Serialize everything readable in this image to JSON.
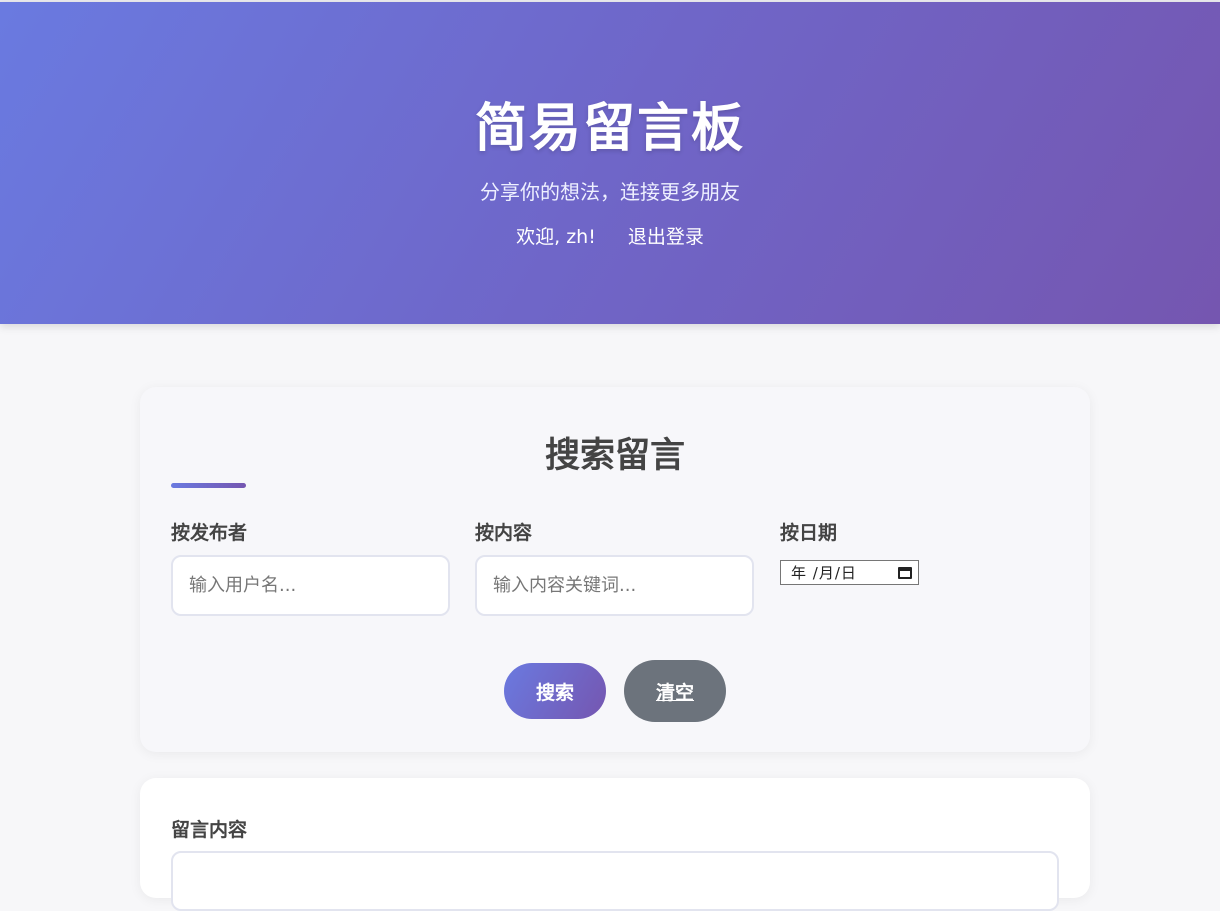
{
  "header": {
    "title": "简易留言板",
    "subtitle": "分享你的想法，连接更多朋友",
    "welcome": "欢迎, zh!",
    "logout_label": "退出登录",
    "gradient_start": "#6a7ae0",
    "gradient_end": "#7556b0"
  },
  "search": {
    "title": "搜索留言",
    "author_label": "按发布者",
    "author_placeholder": "输入用户名...",
    "content_label": "按内容",
    "content_placeholder": "输入内容关键词...",
    "date_label": "按日期",
    "date_display": "年 /月/日",
    "search_button": "搜索",
    "clear_button": "清空",
    "clear_button_color": "#6c737c"
  },
  "message": {
    "content_label": "留言内容"
  }
}
